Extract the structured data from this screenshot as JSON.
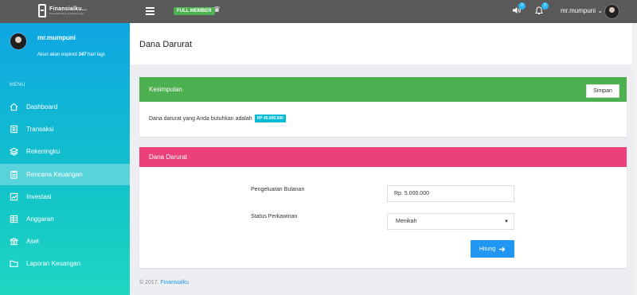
{
  "topbar": {
    "app_name": "Finansialku...",
    "app_tagline": "Personal finance & planning app",
    "member_badge": "FULL MEMBER",
    "crown_icon": "crown-icon",
    "volume_badge": "0",
    "bell_badge": "0",
    "username": "mr.mumpuni",
    "dropdown_caret": "⌄"
  },
  "sidebar": {
    "username": "mr.mumpuni",
    "expire_prefix": "Akun akan expired",
    "expire_days": "347",
    "expire_suffix": "hari lagi.",
    "menu_label": "MENU",
    "items": [
      {
        "label": "Dashboard",
        "icon": "home-icon"
      },
      {
        "label": "Transaksi",
        "icon": "list-icon"
      },
      {
        "label": "Rekeningku",
        "icon": "layers-icon"
      },
      {
        "label": "Rencana Keuangan",
        "icon": "clipboard-icon"
      },
      {
        "label": "Investasi",
        "icon": "chart-icon"
      },
      {
        "label": "Anggaran",
        "icon": "table-icon"
      },
      {
        "label": "Aset",
        "icon": "bank-icon"
      },
      {
        "label": "Laporan Keuangan",
        "icon": "folder-icon"
      }
    ],
    "active_index": 3
  },
  "page": {
    "title": "Dana Darurat"
  },
  "summary": {
    "title": "Kesimpulan",
    "save_label": "Simpan",
    "text": "Dana darurat yang Anda butuhkan adalah",
    "amount": "RP 45.000.000",
    "header_color": "#4caf50"
  },
  "form": {
    "title": "Dana Darurat",
    "header_color": "#ec407a",
    "expense_label": "Pengeluaran Bulanan",
    "expense_value": "Rp. 5.000.000",
    "status_label": "Status Perkawinan",
    "status_value": "Menikah",
    "submit_label": "Hitung"
  },
  "footer": {
    "copyright": "© 2017.",
    "brand": "Finansialku"
  }
}
